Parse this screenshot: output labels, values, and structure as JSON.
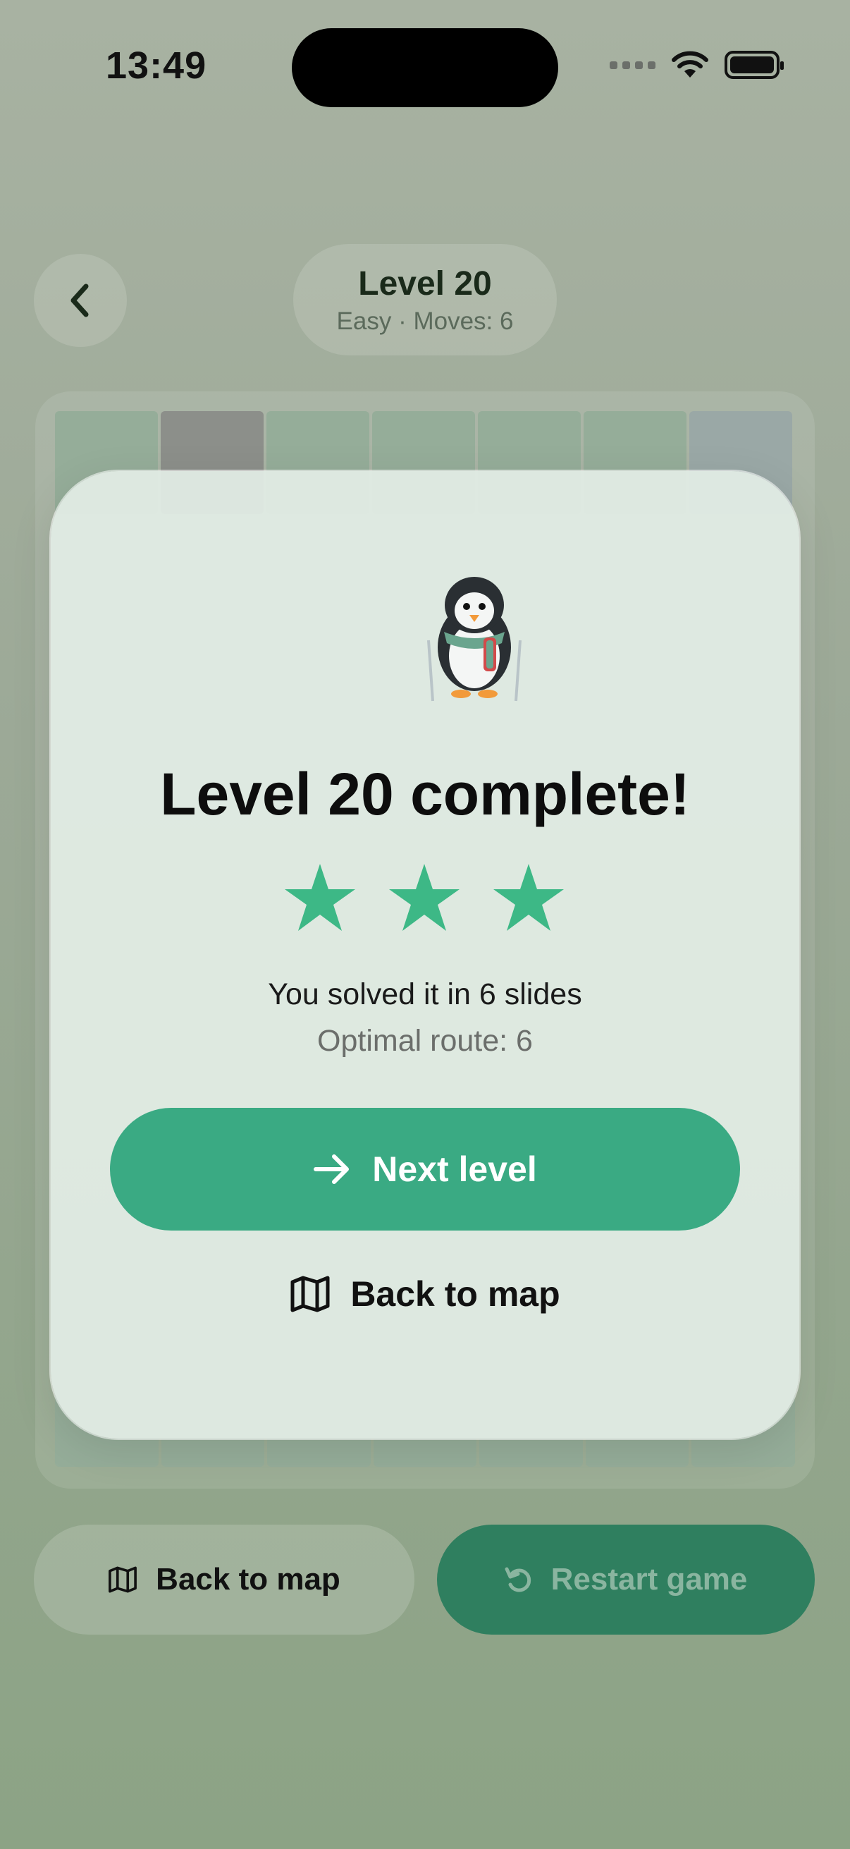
{
  "status_bar": {
    "time": "13:49"
  },
  "header": {
    "back_icon": "chevron-left-icon",
    "level_title": "Level 20",
    "level_subtitle": "Easy · Moves: 6"
  },
  "modal": {
    "title": "Level 20 complete!",
    "stars": 3,
    "stars_max": 3,
    "star_color": "#3db886",
    "solved_text": "You solved it in 6 slides",
    "optimal_text": "Optimal route: 6",
    "next_button_label": "Next level",
    "next_icon": "arrow-right-icon",
    "back_to_map_label": "Back to map",
    "map_icon": "map-icon",
    "accent": "#3aaa83"
  },
  "bottom_bar": {
    "back_to_map_label": "Back to map",
    "restart_label": "Restart game",
    "restart_icon": "rotate-ccw-icon",
    "restart_color": "#2f7f5f"
  }
}
